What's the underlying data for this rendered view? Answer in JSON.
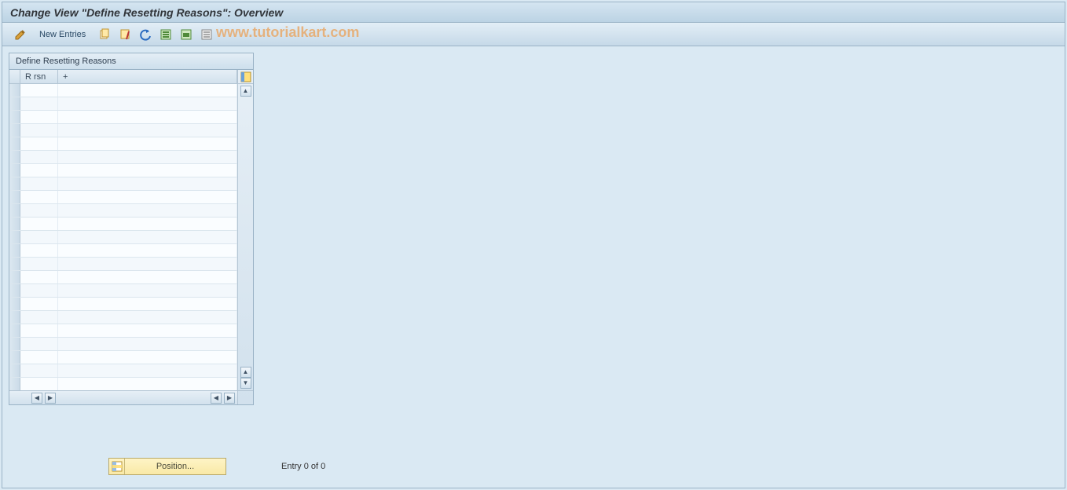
{
  "title": "Change View \"Define Resetting Reasons\": Overview",
  "toolbar": {
    "new_entries": "New Entries"
  },
  "watermark": "www.tutorialkart.com",
  "panel": {
    "title": "Define Resetting Reasons",
    "columns": {
      "rrsn": "R rsn",
      "plus": "+"
    },
    "rows": [
      {
        "rrsn": "",
        "plus": ""
      },
      {
        "rrsn": "",
        "plus": ""
      },
      {
        "rrsn": "",
        "plus": ""
      },
      {
        "rrsn": "",
        "plus": ""
      },
      {
        "rrsn": "",
        "plus": ""
      },
      {
        "rrsn": "",
        "plus": ""
      },
      {
        "rrsn": "",
        "plus": ""
      },
      {
        "rrsn": "",
        "plus": ""
      },
      {
        "rrsn": "",
        "plus": ""
      },
      {
        "rrsn": "",
        "plus": ""
      },
      {
        "rrsn": "",
        "plus": ""
      },
      {
        "rrsn": "",
        "plus": ""
      },
      {
        "rrsn": "",
        "plus": ""
      },
      {
        "rrsn": "",
        "plus": ""
      },
      {
        "rrsn": "",
        "plus": ""
      },
      {
        "rrsn": "",
        "plus": ""
      },
      {
        "rrsn": "",
        "plus": ""
      },
      {
        "rrsn": "",
        "plus": ""
      },
      {
        "rrsn": "",
        "plus": ""
      },
      {
        "rrsn": "",
        "plus": ""
      },
      {
        "rrsn": "",
        "plus": ""
      },
      {
        "rrsn": "",
        "plus": ""
      },
      {
        "rrsn": "",
        "plus": ""
      }
    ]
  },
  "footer": {
    "position_label": "Position...",
    "entry_text": "Entry 0 of 0"
  }
}
